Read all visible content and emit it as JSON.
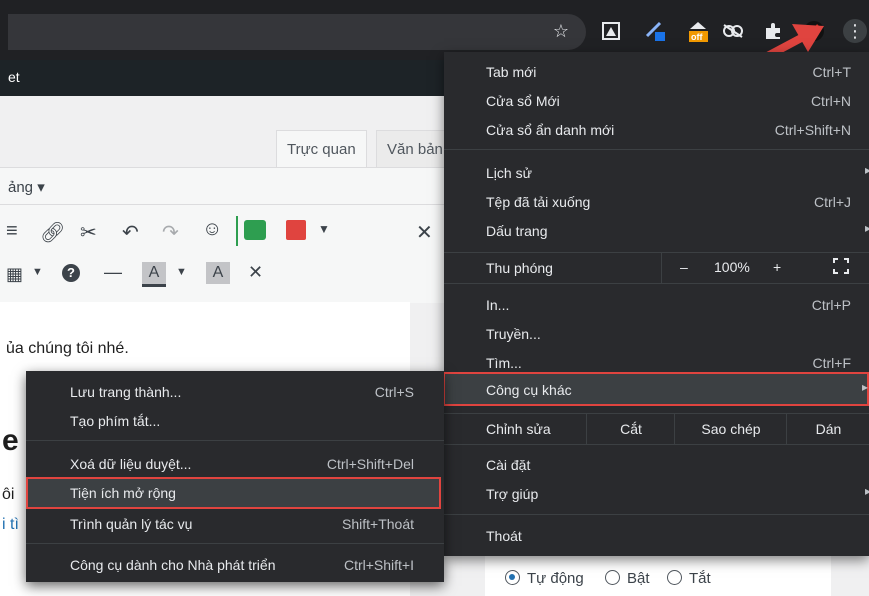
{
  "browser": {
    "icons": [
      "star-icon",
      "screenshot-ext-icon",
      "pen-ext-icon",
      "off-ext-icon",
      "eye-ext-icon",
      "puzzle-icon",
      "profile-icon",
      "kebab-menu-icon"
    ],
    "off_badge": "off"
  },
  "editor": {
    "dark_bar_text": "et",
    "tab_visual": "Trực quan",
    "tab_text": "Văn bản",
    "format_dropdown": "ảng ▾",
    "content_line": "ủa chúng tôi nhé.",
    "heading_fragment": "e",
    "text_fragment_1": "ôi",
    "text_fragment_2": "i tì"
  },
  "main_menu": {
    "items": [
      {
        "label": "Tab mới",
        "shortcut": "Ctrl+T"
      },
      {
        "label": "Cửa sổ Mới",
        "shortcut": "Ctrl+N"
      },
      {
        "label": "Cửa sổ ẩn danh mới",
        "shortcut": "Ctrl+Shift+N"
      },
      {
        "label": "Lịch sử",
        "shortcut": ""
      },
      {
        "label": "Tệp đã tải xuống",
        "shortcut": "Ctrl+J"
      },
      {
        "label": "Dấu trang",
        "shortcut": ""
      },
      {
        "label": "In...",
        "shortcut": "Ctrl+P"
      },
      {
        "label": "Truyền...",
        "shortcut": ""
      },
      {
        "label": "Tìm...",
        "shortcut": "Ctrl+F"
      },
      {
        "label": "Công cụ khác",
        "shortcut": ""
      },
      {
        "label": "Cài đặt",
        "shortcut": ""
      },
      {
        "label": "Trợ giúp",
        "shortcut": ""
      },
      {
        "label": "Thoát",
        "shortcut": ""
      }
    ],
    "zoom": {
      "label": "Thu phóng",
      "minus": "–",
      "value": "100%",
      "plus": "+"
    },
    "edit": {
      "label": "Chỉnh sửa",
      "cut": "Cắt",
      "copy": "Sao chép",
      "paste": "Dán"
    }
  },
  "sub_menu": {
    "items": [
      {
        "label": "Lưu trang thành...",
        "shortcut": "Ctrl+S"
      },
      {
        "label": "Tạo phím tắt...",
        "shortcut": ""
      },
      {
        "label": "Xoá dữ liệu duyệt...",
        "shortcut": "Ctrl+Shift+Del"
      },
      {
        "label": "Tiện ích mở rộng",
        "shortcut": ""
      },
      {
        "label": "Trình quản lý tác vụ",
        "shortcut": "Shift+Thoát"
      },
      {
        "label": "Công cụ dành cho Nhà phát triển",
        "shortcut": "Ctrl+Shift+I"
      }
    ]
  },
  "radio": {
    "options": [
      "Tự động",
      "Bật",
      "Tắt"
    ],
    "selected": "Tự động"
  },
  "colors": {
    "highlight": "#e0443f",
    "menu_bg": "#292a2d",
    "toolbar_bg": "#202124"
  }
}
